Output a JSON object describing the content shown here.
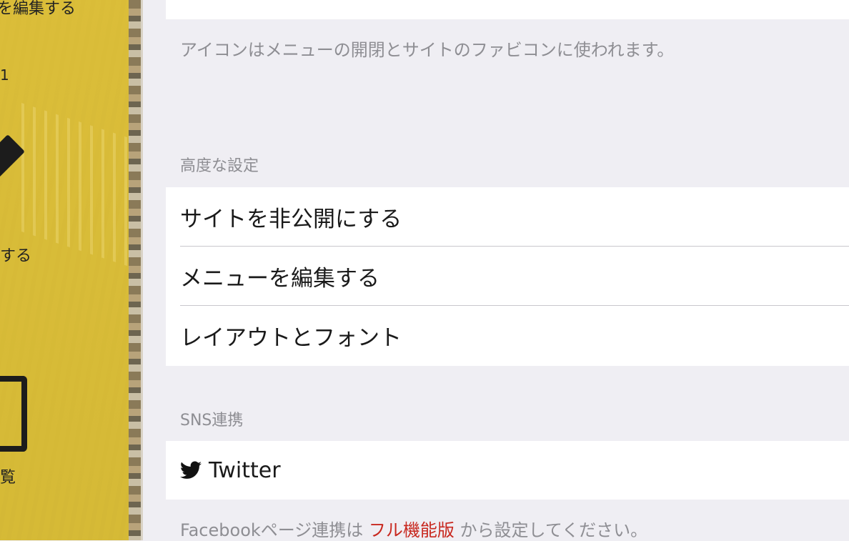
{
  "sidebar": {
    "top_label": "を編集する",
    "number": "1",
    "edit_label": "する",
    "list_label": "覧"
  },
  "panel": {
    "icon_note": "アイコンはメニューの開閉とサイトのファビコンに使われます。",
    "advanced": {
      "header": "高度な設定",
      "items": [
        {
          "label": "サイトを非公開にする"
        },
        {
          "label": "メニューを編集する"
        },
        {
          "label": "レイアウトとフォント"
        }
      ]
    },
    "sns": {
      "header": "SNS連携",
      "twitter_label": "Twitter",
      "facebook_note_before": "Facebookページ連携は ",
      "facebook_link": "フル機能版",
      "facebook_note_after": " から設定してください。"
    }
  },
  "colors": {
    "sidebar_yellow": "#d9bd37",
    "link_red": "#c8281f",
    "note_gray": "#8e8e93",
    "background": "#efeef3"
  }
}
